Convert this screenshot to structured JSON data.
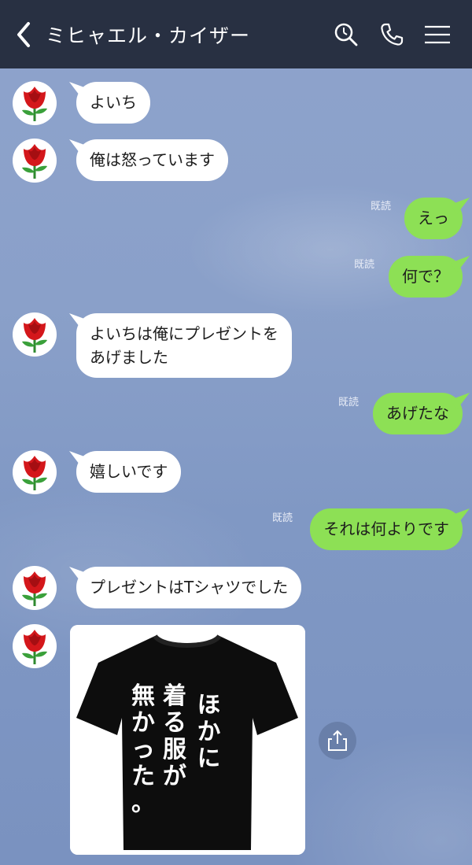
{
  "header": {
    "title": "ミヒャエル・カイザー",
    "background": "#283042"
  },
  "colors": {
    "incoming_bubble": "#ffffff",
    "outgoing_bubble": "#8de055",
    "background": "#8aa0c9"
  },
  "messages": [
    {
      "side": "in",
      "text": "よいち"
    },
    {
      "side": "in",
      "text": "俺は怒っています"
    },
    {
      "side": "out",
      "text": "えっ",
      "read": "既読"
    },
    {
      "side": "out",
      "text": "何で？",
      "read": "既読"
    },
    {
      "side": "in",
      "text": "よいちは俺にプレゼントを\nあげました"
    },
    {
      "side": "out",
      "text": "あげたな",
      "read": "既読"
    },
    {
      "side": "in",
      "text": "嬉しいです"
    },
    {
      "side": "out",
      "text": "それは何よりです",
      "read": "既読"
    },
    {
      "side": "in",
      "text": "プレゼントはTシャツでした"
    },
    {
      "side": "in",
      "type": "image",
      "image_text": [
        "ほかに",
        "着る服が",
        "無かった。"
      ]
    }
  ]
}
